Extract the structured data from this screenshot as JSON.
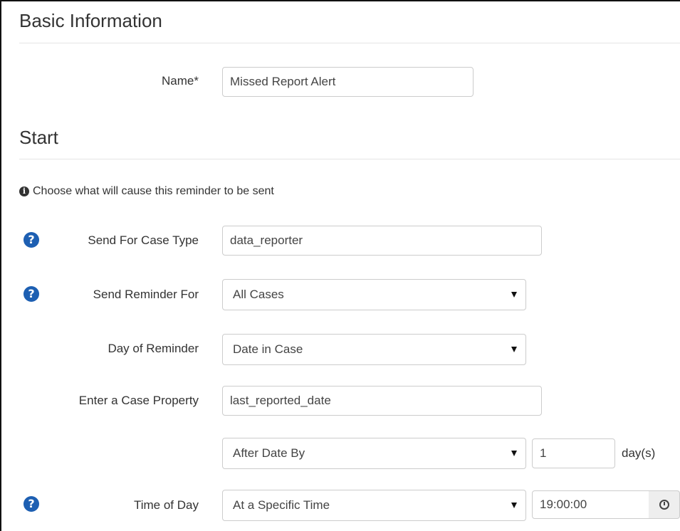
{
  "sections": {
    "basic": "Basic Information",
    "start": "Start"
  },
  "info_text": "Choose what will cause this reminder to be sent",
  "fields": {
    "name": {
      "label": "Name*",
      "value": "Missed Report Alert"
    },
    "case_type": {
      "label": "Send For Case Type",
      "value": "data_reporter"
    },
    "reminder_for": {
      "label": "Send Reminder For",
      "value": "All Cases"
    },
    "day_of_reminder": {
      "label": "Day of Reminder",
      "value": "Date in Case"
    },
    "case_property": {
      "label": "Enter a Case Property",
      "value": "last_reported_date"
    },
    "offset": {
      "value": "After Date By",
      "number": "1",
      "unit": "day(s)"
    },
    "time_of_day": {
      "label": "Time of Day",
      "value": "At a Specific Time",
      "time": "19:00:00"
    }
  },
  "icons": {
    "help": "question-circle-icon",
    "info": "info-circle-icon",
    "clock": "clock-icon"
  },
  "colors": {
    "help_icon": "#1d5fb2",
    "border": "#cccccc",
    "text": "#333333"
  }
}
